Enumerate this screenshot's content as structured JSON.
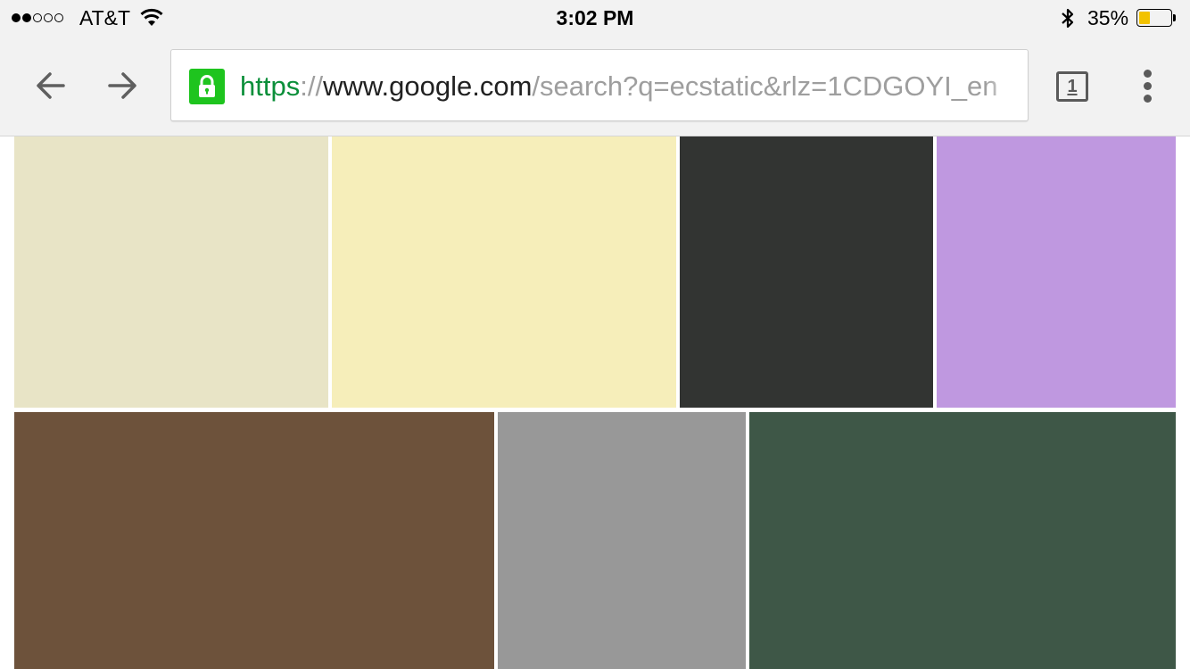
{
  "status_bar": {
    "carrier": "AT&T",
    "time": "3:02 PM",
    "battery_percent": "35%",
    "battery_level": 0.35,
    "signal_bars_filled": 2,
    "signal_bars_total": 5,
    "icons": [
      "signal-dots-icon",
      "wifi-icon",
      "bluetooth-icon",
      "battery-icon"
    ]
  },
  "toolbar": {
    "back_icon": "arrow-left-icon",
    "forward_icon": "arrow-right-icon",
    "lock_icon": "lock-icon",
    "url": {
      "scheme": "https",
      "separator": "://",
      "host": "www.google.com",
      "path": "/search?q=ecstatic&rlz=1CDGOYI_en"
    },
    "tab_count": "1",
    "menu_icon": "more-vert-icon"
  },
  "colors": {
    "secure_green": "#1ec41e",
    "url_scheme_green": "#0b8f3a",
    "battery_yellow": "#f2c200",
    "chrome_bg": "#f2f2f2"
  },
  "image_results": [
    {
      "color": "#e8e4c6"
    },
    {
      "color": "#f6eeba"
    },
    {
      "color": "#323432"
    },
    {
      "color": "#bf98e0"
    },
    {
      "color": "#6d523b"
    },
    {
      "color": "#989898"
    },
    {
      "color": "#3e5747"
    }
  ]
}
